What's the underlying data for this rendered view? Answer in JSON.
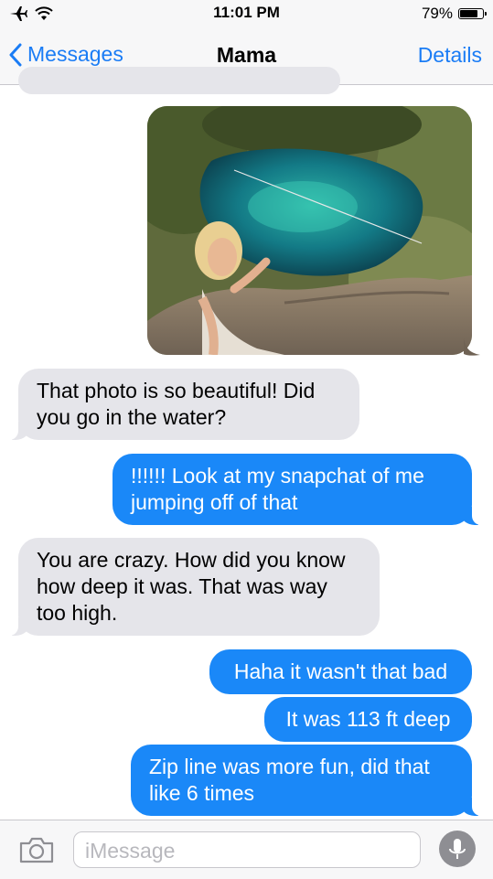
{
  "status": {
    "time": "11:01 PM",
    "battery_text": "79%",
    "battery_level": 0.79
  },
  "nav": {
    "back_label": "Messages",
    "title": "Mama",
    "details_label": "Details"
  },
  "messages": [
    {
      "sender": "me",
      "type": "photo",
      "icon": "photo-cenote-selfie"
    },
    {
      "sender": "them",
      "text": "That photo is so beautiful! Did you go in the water?"
    },
    {
      "sender": "me",
      "text": "!!!!!! Look at my snapchat of me jumping off of that"
    },
    {
      "sender": "them",
      "text": "You are crazy. How did you know how deep it was. That was way too high."
    },
    {
      "sender": "me",
      "text": "Haha it wasn't that bad"
    },
    {
      "sender": "me",
      "text": "It was 113 ft deep"
    },
    {
      "sender": "me",
      "text": "Zip line was more fun, did that like 6 times"
    }
  ],
  "input": {
    "placeholder": "iMessage",
    "camera_icon": "camera-icon",
    "mic_icon": "microphone-icon"
  },
  "colors": {
    "accent": "#1a7cf5",
    "outgoing_bubble": "#1a88f8",
    "incoming_bubble": "#e5e5ea",
    "bar_background": "#f7f7f8"
  }
}
